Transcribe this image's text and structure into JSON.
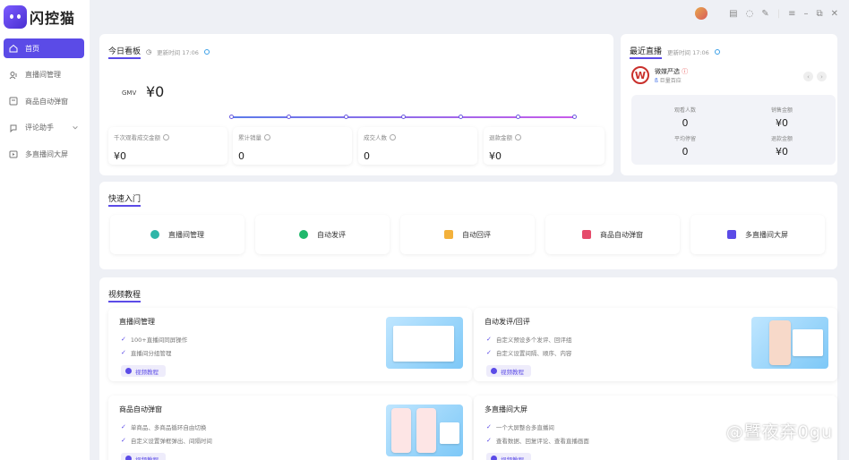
{
  "app": {
    "name": "闪控猫"
  },
  "sidebar": {
    "items": [
      {
        "label": "首页"
      },
      {
        "label": "直播间管理"
      },
      {
        "label": "商品自动弹窗"
      },
      {
        "label": "评论助手"
      },
      {
        "label": "多直播间大屏"
      }
    ]
  },
  "today": {
    "title": "今日看板",
    "updated": "更新时间 17:06",
    "gmv_label": "GMV",
    "gmv_value": "¥0",
    "metrics": [
      {
        "label": "千次观看成交金额",
        "value": "¥0"
      },
      {
        "label": "累计销量",
        "value": "0"
      },
      {
        "label": "成交人数",
        "value": "0"
      },
      {
        "label": "退款金额",
        "value": "¥0"
      }
    ]
  },
  "recent_live": {
    "title": "最近直播",
    "updated": "更新时间 17:06",
    "name": "微媒严选",
    "sub": "巨量百应",
    "stats": [
      {
        "label": "观看人数",
        "value": "0"
      },
      {
        "label": "销售金额",
        "value": "¥0"
      },
      {
        "label": "平均停留",
        "value": "0"
      },
      {
        "label": "退款金额",
        "value": "¥0"
      }
    ]
  },
  "quick": {
    "title": "快速入门",
    "items": [
      {
        "label": "直播间管理",
        "color": "#2fb6a8"
      },
      {
        "label": "自动发评",
        "color": "#1fb86b"
      },
      {
        "label": "自动回评",
        "color": "#f3b13b"
      },
      {
        "label": "商品自动弹窗",
        "color": "#e54b6b"
      },
      {
        "label": "多直播间大屏",
        "color": "#5b4be7"
      }
    ]
  },
  "tutorials": {
    "title": "视频教程",
    "button": "视频教程",
    "items": [
      {
        "title": "直播间管理",
        "features": [
          "100+直播间同屏操作",
          "直播间分组管理"
        ]
      },
      {
        "title": "自动发评/回评",
        "features": [
          "自定义预设多个发评、回评组",
          "自定义设置间隔、顺序、内容"
        ]
      },
      {
        "title": "商品自动弹窗",
        "features": [
          "单商品、多商品循环自由切换",
          "自定义设置弹框弹出、间隔时间"
        ]
      },
      {
        "title": "多直播间大屏",
        "features": [
          "一个大屏整合多直播间",
          "查看数据、回复评论、查看直播画面"
        ]
      }
    ]
  },
  "watermark": "@暨夜弃0gu"
}
